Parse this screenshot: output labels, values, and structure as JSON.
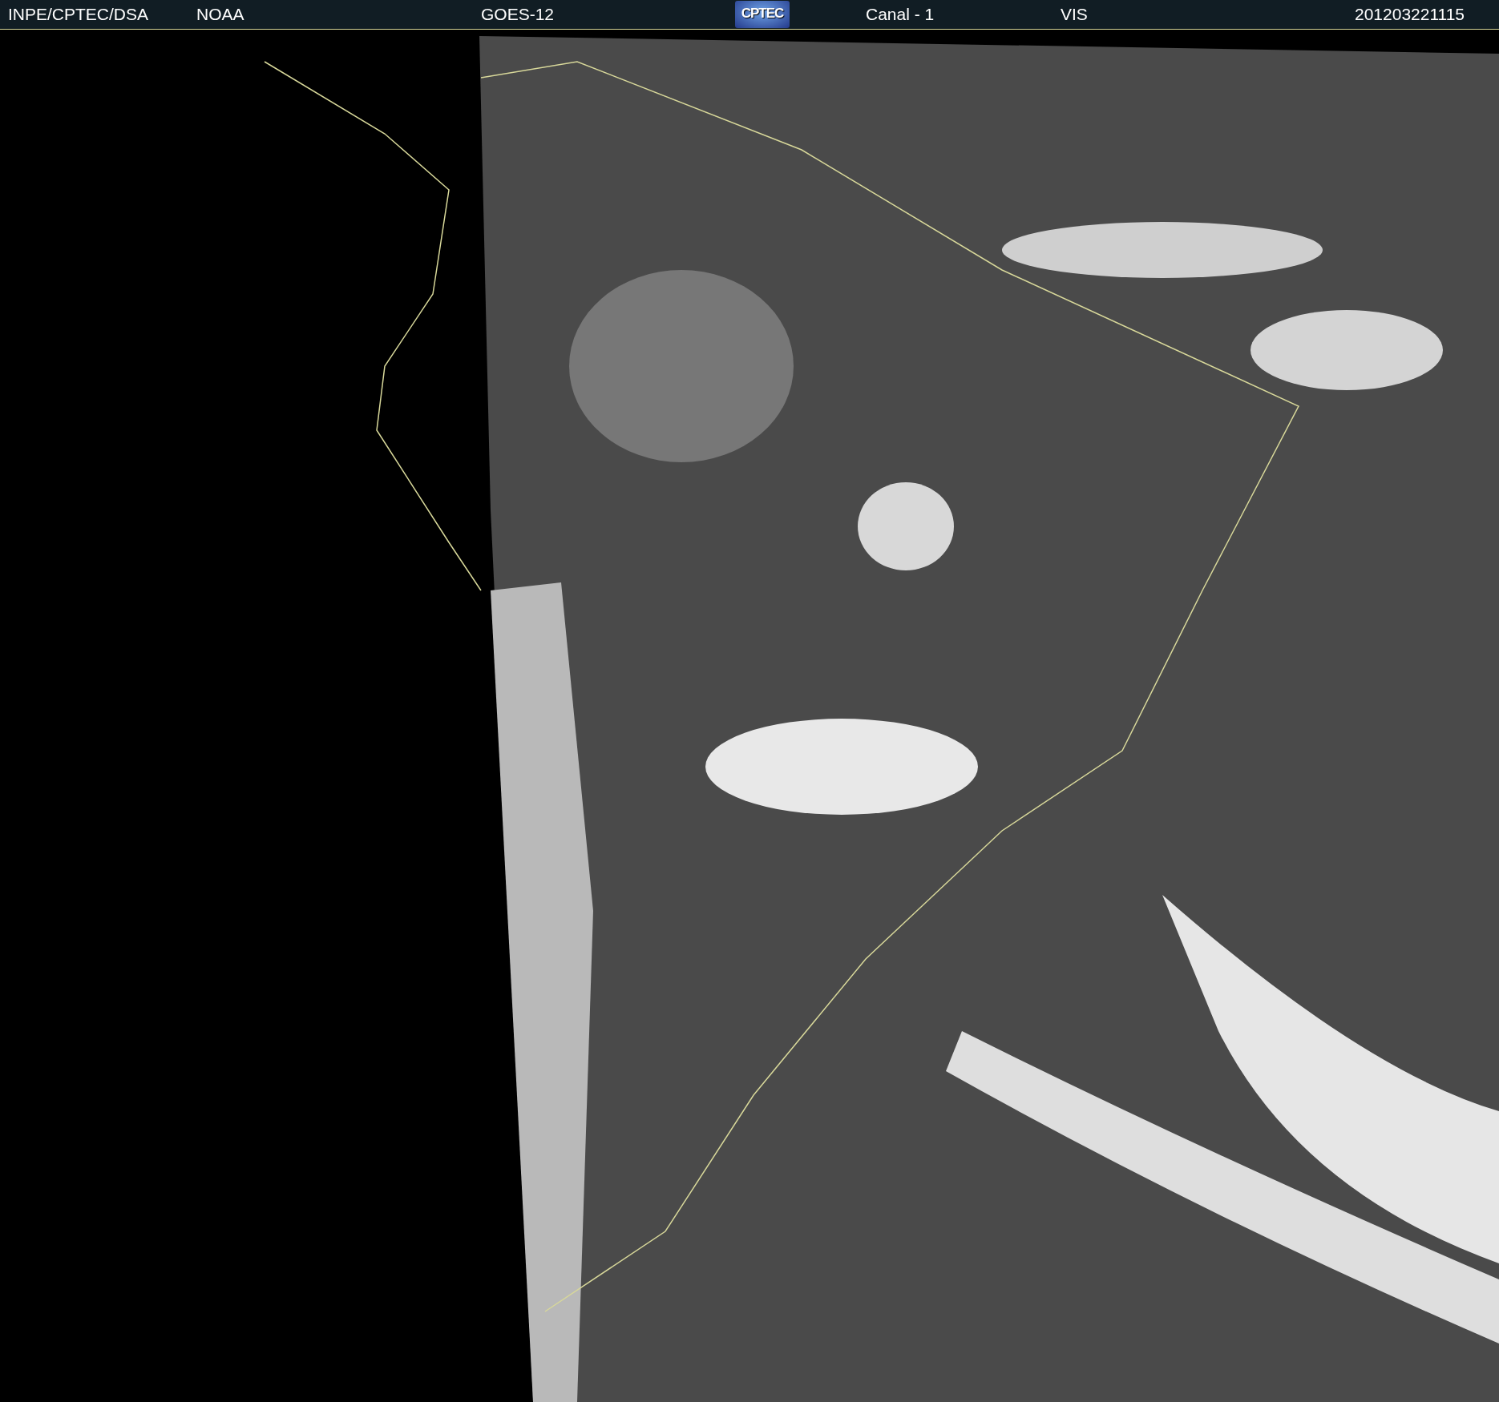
{
  "header": {
    "items": [
      {
        "kind": "text",
        "text": "INPE/CPTEC/DSA"
      },
      {
        "kind": "text",
        "text": "NOAA"
      },
      {
        "kind": "text",
        "text": "GOES-12"
      },
      {
        "kind": "logo",
        "text": "CPTEC"
      },
      {
        "kind": "text",
        "text": "Canal - 1"
      },
      {
        "kind": "text",
        "text": "VIS"
      },
      {
        "kind": "text",
        "text": "201203221115"
      }
    ]
  }
}
